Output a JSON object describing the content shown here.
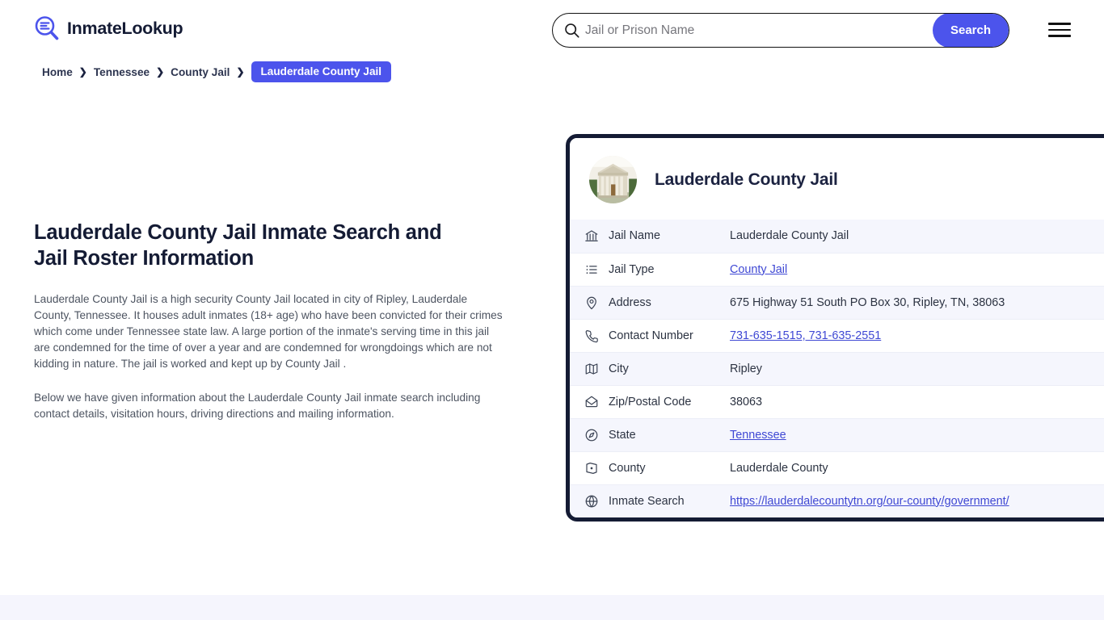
{
  "header": {
    "logo_text": "InmateLookup",
    "logo_icon": "magnifier-list-icon",
    "search": {
      "placeholder": "Jail or Prison Name",
      "value": "",
      "icon": "search-icon",
      "button_label": "Search"
    },
    "menu_icon": "hamburger-menu-icon"
  },
  "breadcrumb": {
    "items": [
      {
        "label": "Home",
        "active": false
      },
      {
        "label": "Tennessee",
        "active": false
      },
      {
        "label": "County Jail",
        "active": false
      },
      {
        "label": "Lauderdale County Jail",
        "active": true
      }
    ],
    "separator": "❯"
  },
  "main": {
    "title": "Lauderdale County Jail Inmate Search and Jail Roster Information",
    "paragraphs": [
      "Lauderdale County Jail is a high security County Jail located in city of Ripley, Lauderdale County, Tennessee. It houses adult inmates (18+ age) who have been convicted for their crimes which come under Tennessee state law. A large portion of the inmate's serving time in this jail are condemned for the time of over a year and are condemned for wrongdoings which are not kidding in nature. The jail is worked and kept up by County Jail .",
      "Below we have given information about the Lauderdale County Jail inmate search including contact details, visitation hours, driving directions and mailing information."
    ]
  },
  "card": {
    "avatar_icon": "courthouse-photo",
    "title": "Lauderdale County Jail",
    "rows": [
      {
        "icon": "bank-icon",
        "label": "Jail Name",
        "value": "Lauderdale County Jail",
        "link": false
      },
      {
        "icon": "list-icon",
        "label": "Jail Type",
        "value": "County Jail",
        "link": true
      },
      {
        "icon": "location-icon",
        "label": "Address",
        "value": "675 Highway 51 South PO Box 30, Ripley, TN, 38063",
        "link": false
      },
      {
        "icon": "phone-icon",
        "label": "Contact Number",
        "value": "731-635-1515, 731-635-2551",
        "link": true
      },
      {
        "icon": "map-icon",
        "label": "City",
        "value": "Ripley",
        "link": false
      },
      {
        "icon": "envelope-icon",
        "label": "Zip/Postal Code",
        "value": "38063",
        "link": false
      },
      {
        "icon": "compass-icon",
        "label": "State",
        "value": "Tennessee",
        "link": true
      },
      {
        "icon": "county-icon",
        "label": "County",
        "value": "Lauderdale County",
        "link": false
      },
      {
        "icon": "globe-icon",
        "label": "Inmate Search",
        "value": "https://lauderdalecountytn.org/our-county/government/",
        "link": true
      }
    ]
  },
  "colors": {
    "accent": "#4c54ec",
    "dark": "#141b34",
    "link": "#3f48d4",
    "row_alt": "#f5f6fd",
    "bottom_band": "#f5f5fd"
  }
}
